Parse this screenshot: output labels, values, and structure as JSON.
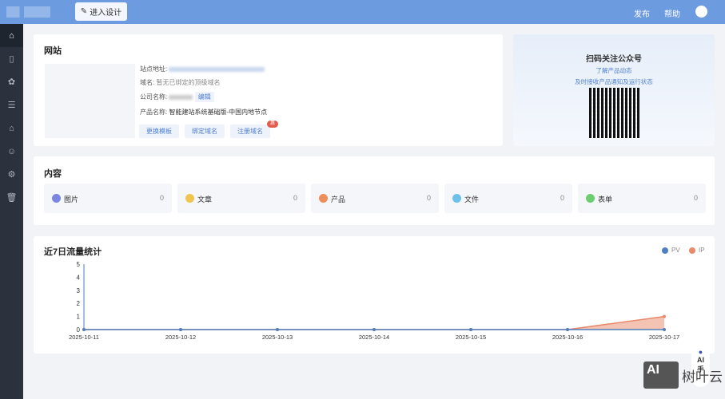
{
  "header": {
    "design_label": "进入设计",
    "publish": "发布",
    "help": "帮助"
  },
  "site": {
    "title": "网站",
    "addr_label": "站点地址:",
    "domain_label": "域名:",
    "domain_value": "暂无已绑定的顶级域名",
    "company_label": "公司名称:",
    "edit": "编辑",
    "product_label": "产品名称:",
    "product_value": "智能建站系统基础版-中国内地节点",
    "buttons": [
      "更换模板",
      "绑定域名",
      "注册域名"
    ],
    "badge": "惠"
  },
  "qr": {
    "title": "扫码关注公众号",
    "line1": "了解产品动态",
    "line2": "及时接收产品通知及运行状态"
  },
  "content": {
    "title": "内容",
    "items": [
      {
        "label": "图片",
        "value": "0",
        "color": "#7b86e0"
      },
      {
        "label": "文章",
        "value": "0",
        "color": "#f0c44f"
      },
      {
        "label": "产品",
        "value": "0",
        "color": "#ee8e5a"
      },
      {
        "label": "文件",
        "value": "0",
        "color": "#6cc1ea"
      },
      {
        "label": "表单",
        "value": "0",
        "color": "#6bcf6f"
      }
    ]
  },
  "traffic": {
    "title": "近7日流量统计"
  },
  "chart_data": {
    "type": "area",
    "title": "近7日流量统计",
    "x": [
      "2025-10-11",
      "2025-10-12",
      "2025-10-13",
      "2025-10-14",
      "2025-10-15",
      "2025-10-16",
      "2025-10-17"
    ],
    "series": [
      {
        "name": "PV",
        "values": [
          0,
          0,
          0,
          0,
          0,
          0,
          0
        ],
        "color": "#4e7fbf"
      },
      {
        "name": "IP",
        "values": [
          0,
          0,
          0,
          0,
          0,
          0,
          1
        ],
        "color": "#e8896a"
      }
    ],
    "ylim": [
      0,
      5
    ],
    "yticks": [
      0,
      1,
      2,
      3,
      4,
      5
    ],
    "legend": "top-right"
  },
  "assistant": {
    "label": "AI",
    "sub": "手"
  },
  "watermark": {
    "text": "树叶云",
    "box": "AI"
  }
}
